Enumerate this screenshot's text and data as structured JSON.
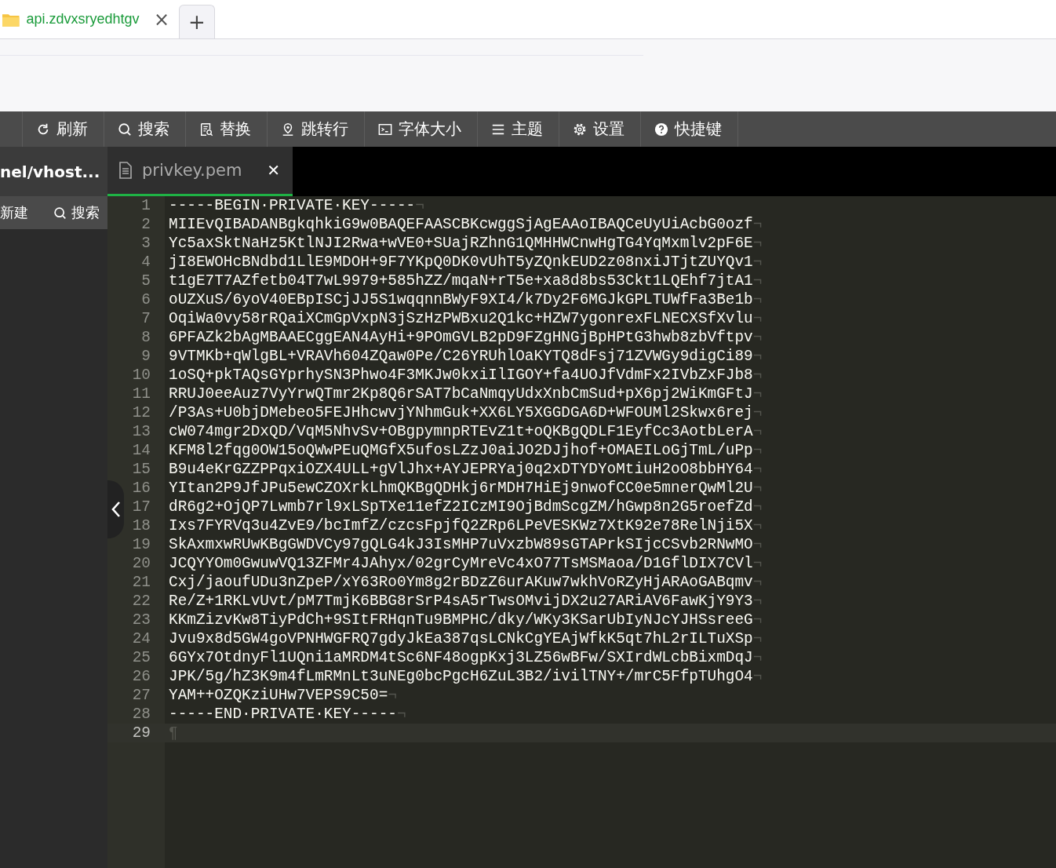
{
  "browser_tab": {
    "title": "api.zdvxsryedhtgv",
    "close": "×",
    "new_tab": "+"
  },
  "toolbar": [
    {
      "kind": "refresh",
      "label": "刷新"
    },
    {
      "kind": "search",
      "label": "搜索"
    },
    {
      "kind": "replace",
      "label": "替换"
    },
    {
      "kind": "goto",
      "label": "跳转行"
    },
    {
      "kind": "font",
      "label": "字体大小"
    },
    {
      "kind": "theme",
      "label": "主题"
    },
    {
      "kind": "settings",
      "label": "设置"
    },
    {
      "kind": "help",
      "label": "快捷键"
    }
  ],
  "sidebar": {
    "path": "nel/vhost...",
    "actions": [
      {
        "kind": "new",
        "label": "新建"
      },
      {
        "kind": "search",
        "label": "搜索"
      }
    ]
  },
  "editor_tabs": [
    {
      "label": "privkey.pem",
      "selected": true,
      "close": "✕"
    }
  ],
  "lines": [
    {
      "number": "1",
      "text": "-----BEGIN·PRIVATE·KEY-----",
      "eol": "¬",
      "current": false
    },
    {
      "number": "2",
      "text": "MIIEvQIBADANBgkqhkiG9w0BAQEFAASCBKcwggSjAgEAAoIBAQCeUyUiAcbG0ozf",
      "eol": "¬",
      "current": false
    },
    {
      "number": "3",
      "text": "Yc5axSktNaHz5KtlNJI2Rwa+wVE0+SUajRZhnG1QMHHWCnwHgTG4YqMxmlv2pF6E",
      "eol": "¬",
      "current": false
    },
    {
      "number": "4",
      "text": "jI8EWOHcBNdbd1LlE9MDOH+9F7YKpQ0DK0vUhT5yZQnkEUD2z08nxiJTjtZUYQv1",
      "eol": "¬",
      "current": false
    },
    {
      "number": "5",
      "text": "t1gE7T7AZfetb04T7wL9979+585hZZ/mqaN+rT5e+xa8d8bs53Ckt1LQEhf7jtA1",
      "eol": "¬",
      "current": false
    },
    {
      "number": "6",
      "text": "oUZXuS/6yoV40EBpISCjJJ5S1wqqnnBWyF9XI4/k7Dy2F6MGJkGPLTUWfFa3Be1b",
      "eol": "¬",
      "current": false
    },
    {
      "number": "7",
      "text": "OqiWa0vy58rRQaiXCmGpVxpN3jSzHzPWBxu2Q1kc+HZW7ygonrexFLNECXSfXvlu",
      "eol": "¬",
      "current": false
    },
    {
      "number": "8",
      "text": "6PFAZk2bAgMBAAECggEAN4AyHi+9POmGVLB2pD9FZgHNGjBpHPtG3hwb8zbVftpv",
      "eol": "¬",
      "current": false
    },
    {
      "number": "9",
      "text": "9VTMKb+qWlgBL+VRAVh604ZQaw0Pe/C26YRUhlOaKYTQ8dFsj71ZVWGy9digCi89",
      "eol": "¬",
      "current": false
    },
    {
      "number": "10",
      "text": "1oSQ+pkTAQsGYprhySN3Phwo4F3MKJw0kxiIlIGOY+fa4UOJfVdmFx2IVbZxFJb8",
      "eol": "¬",
      "current": false
    },
    {
      "number": "11",
      "text": "RRUJ0eeAuz7VyYrwQTmr2Kp8Q6rSAT7bCaNmqyUdxXnbCmSud+pX6pj2WiKmGFtJ",
      "eol": "¬",
      "current": false
    },
    {
      "number": "12",
      "text": "/P3As+U0bjDMebeo5FEJHhcwvjYNhmGuk+XX6LY5XGGDGA6D+WFOUMl2Skwx6rej",
      "eol": "¬",
      "current": false
    },
    {
      "number": "13",
      "text": "cW074mgr2DxQD/VqM5NhvSv+OBgpymnpRTEvZ1t+oQKBgQDLF1EyfCc3AotbLerA",
      "eol": "¬",
      "current": false
    },
    {
      "number": "14",
      "text": "KFM8l2fqg0OW15oQWwPEuQMGfX5ufosLZzJ0aiJO2DJjhof+OMAEILoGjTmL/uPp",
      "eol": "¬",
      "current": false
    },
    {
      "number": "15",
      "text": "B9u4eKrGZZPPqxiOZX4ULL+gVlJhx+AYJEPRYaj0q2xDTYDYoMtiuH2oO8bbHY64",
      "eol": "¬",
      "current": false
    },
    {
      "number": "16",
      "text": "YItan2P9JfJPu5ewCZOXrkLhmQKBgQDHkj6rMDH7HiEj9nwofCC0e5mnerQwMl2U",
      "eol": "¬",
      "current": false
    },
    {
      "number": "17",
      "text": "dR6g2+OjQP7Lwmb7rl9xLSpTXe11efZ2ICzMI9OjBdmScgZM/hGwp8n2G5roefZd",
      "eol": "¬",
      "current": false
    },
    {
      "number": "18",
      "text": "Ixs7FYRVq3u4ZvE9/bcImfZ/czcsFpjfQ2ZRp6LPeVESKWz7XtK92e78RelNji5X",
      "eol": "¬",
      "current": false
    },
    {
      "number": "19",
      "text": "SkAxmxwRUwKBgGWDVCy97gQLG4kJ3IsMHP7uVxzbW89sGTAPrkSIjcCSvb2RNwMO",
      "eol": "¬",
      "current": false
    },
    {
      "number": "20",
      "text": "JCQYYOm0GwuwVQ13ZFMr4JAhyx/02grCyMreVc4xO77TsMSMaoa/D1GflDIX7CVl",
      "eol": "¬",
      "current": false
    },
    {
      "number": "21",
      "text": "Cxj/jaoufUDu3nZpeP/xY63Ro0Ym8g2rBDzZ6urAKuw7wkhVoRZyHjARAoGABqmv",
      "eol": "¬",
      "current": false
    },
    {
      "number": "22",
      "text": "Re/Z+1RKLvUvt/pM7TmjK6BBG8rSrP4sA5rTwsOMvijDX2u27ARiAV6FawKjY9Y3",
      "eol": "¬",
      "current": false
    },
    {
      "number": "23",
      "text": "KKmZizvKw8TiyPdCh+9SItFRHqnTu9BMPHC/dky/WKy3KSarUbIyNJcYJHSsreeG",
      "eol": "¬",
      "current": false
    },
    {
      "number": "24",
      "text": "Jvu9x8d5GW4goVPNHWGFRQ7gdyJkEa387qsLCNkCgYEAjWfkK5qt7hL2rILTuXSp",
      "eol": "¬",
      "current": false
    },
    {
      "number": "25",
      "text": "6GYx7OtdnyFl1UQni1aMRDM4tSc6NF48ogpKxj3LZ56wBFw/SXIrdWLcbBixmDqJ",
      "eol": "¬",
      "current": false
    },
    {
      "number": "26",
      "text": "JPK/5g/hZ3K9m4fLmRMnLt3uNEg0bcPgcH6ZuL3B2/ivilTNY+/mrC5FfpTUhgO4",
      "eol": "¬",
      "current": false
    },
    {
      "number": "27",
      "text": "YAM++OZQKziUHw7VEPS9C50=",
      "eol": "¬",
      "current": false
    },
    {
      "number": "28",
      "text": "-----END·PRIVATE·KEY-----",
      "eol": "¬",
      "current": false
    },
    {
      "number": "29",
      "eol": "¶",
      "current": true
    }
  ]
}
